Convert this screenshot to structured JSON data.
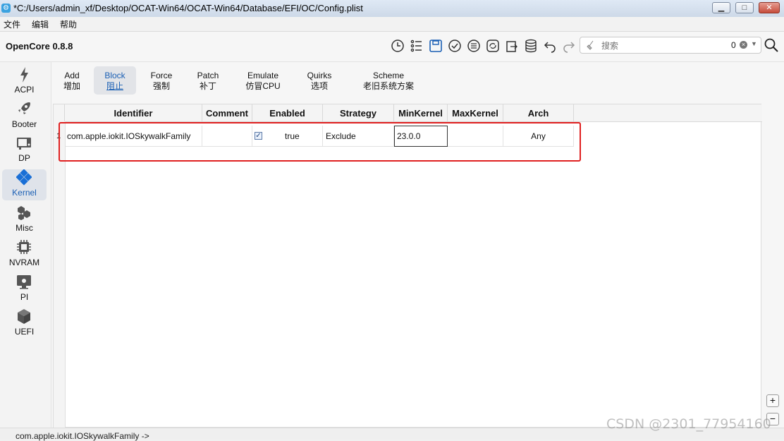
{
  "window": {
    "title": "*C:/Users/admin_xf/Desktop/OCAT-Win64/OCAT-Win64/Database/EFI/OC/Config.plist"
  },
  "menu": [
    "文件",
    "编辑",
    "帮助"
  ],
  "toolbar": {
    "app_name": "OpenCore 0.8.8",
    "search_placeholder": "搜索",
    "search_count": "0"
  },
  "sidebar": {
    "items": [
      {
        "label": "ACPI",
        "icon": "lightning-icon"
      },
      {
        "label": "Booter",
        "icon": "rocket-icon"
      },
      {
        "label": "DP",
        "icon": "display-icon"
      },
      {
        "label": "Kernel",
        "icon": "kernel-icon",
        "active": true
      },
      {
        "label": "Misc",
        "icon": "cubes-icon"
      },
      {
        "label": "NVRAM",
        "icon": "chip-icon"
      },
      {
        "label": "PI",
        "icon": "apple-monitor-icon"
      },
      {
        "label": "UEFI",
        "icon": "box-icon"
      }
    ]
  },
  "tabs": [
    {
      "en": "Add",
      "zh": "增加"
    },
    {
      "en": "Block",
      "zh": "阻止",
      "active": true
    },
    {
      "en": "Force",
      "zh": "强制"
    },
    {
      "en": "Patch",
      "zh": "补丁"
    },
    {
      "en": "Emulate",
      "zh": "仿冒CPU"
    },
    {
      "en": "Quirks",
      "zh": "选项"
    },
    {
      "en": "Scheme",
      "zh": "老旧系统方案"
    }
  ],
  "table": {
    "headers": [
      "Identifier",
      "Comment",
      "Enabled",
      "Strategy",
      "MinKernel",
      "MaxKernel",
      "Arch"
    ],
    "row": {
      "num": "1",
      "identifier": "com.apple.iokit.IOSkywalkFamily",
      "comment": "",
      "enabled_checked": true,
      "enabled": "true",
      "strategy": "Exclude",
      "minkernel": "23.0.0",
      "maxkernel": "",
      "arch": "Any"
    }
  },
  "buttons": {
    "add": "+",
    "remove": "−"
  },
  "status": {
    "text": "com.apple.iokit.IOSkywalkFamily ->"
  },
  "watermark": "CSDN @2301_77954160",
  "colors": {
    "accent": "#1a5fb4",
    "highlight": "#e02020"
  }
}
